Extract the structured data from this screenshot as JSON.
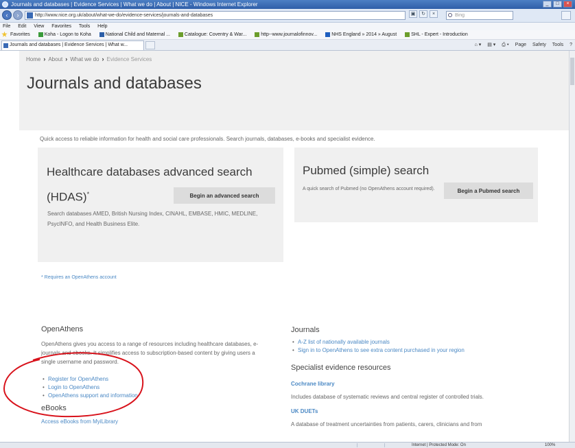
{
  "browser": {
    "title": "Journals and databases | Evidence Services | What we do | About | NICE - Windows Internet Explorer",
    "address": "http://www.nice.org.uk/about/what-we-do/evidence-services/journals-and-databases",
    "search_placeholder": "Bing",
    "menu": [
      "File",
      "Edit",
      "View",
      "Favorites",
      "Tools",
      "Help"
    ],
    "favorites_label": "Favorites",
    "favorites": [
      "Koha - Logon to Koha",
      "National Child and Maternal ...",
      "Catalogue: Coventry & War...",
      "http--www.journalofinnov...",
      "NHS England » 2014 » August",
      "SHL - Expert - Introduction"
    ],
    "tab_title": "Journals and databases | Evidence Services | What w...",
    "command_bar": [
      "Page",
      "Safety",
      "Tools"
    ],
    "status_zone": "Internet | Protected Mode: On",
    "zoom": "100%"
  },
  "page": {
    "breadcrumb": [
      "Home",
      "About",
      "What we do",
      "Evidence Services"
    ],
    "title": "Journals and databases",
    "intro": "Quick access to reliable information for health and social care professionals. Search journals, databases, e-books and specialist evidence.",
    "hdas": {
      "title": "Healthcare databases advanced search (HDAS)",
      "title_mark": "*",
      "description": "Search databases AMED, British Nursing Index, CINAHL, EMBASE, HMIC, MEDLINE, PsycINFO, and Health Business Elite.",
      "button": "Begin an advanced search"
    },
    "pubmed": {
      "title": "Pubmed (simple) search",
      "description": "A quick search of Pubmed (no OpenAthens account required).",
      "button": "Begin a Pubmed search"
    },
    "footnote": "* Requires an OpenAthens account",
    "openathens": {
      "heading": "OpenAthens",
      "text": "OpenAthens gives you access to a range of resources including healthcare databases, e-journals and ebooks. It simplifies access to subscription-based content by giving users a single username and password.",
      "links": [
        "Register for OpenAthens",
        "Login to OpenAthens",
        "OpenAthens support and information"
      ]
    },
    "ebooks": {
      "heading": "eBooks",
      "link": "Access eBooks from MyiLibrary"
    },
    "journals": {
      "heading": "Journals",
      "links": [
        "A-Z list of nationally available journals",
        "Sign in to OpenAthens to see extra content purchased in your region"
      ]
    },
    "specialist": {
      "heading": "Specialist evidence resources",
      "cochrane_title": "Cochrane library",
      "cochrane_text": "Includes database of systematic reviews and central register of controlled trials.",
      "uk_duets_title": "UK DUETs",
      "uk_duets_text": "A database of treatment uncertainties from patients, carers, clinicians and from"
    }
  },
  "colors": {
    "link": "#4a88c4",
    "panel_bg": "#f0f0f0",
    "annotation": "#d8121b"
  }
}
